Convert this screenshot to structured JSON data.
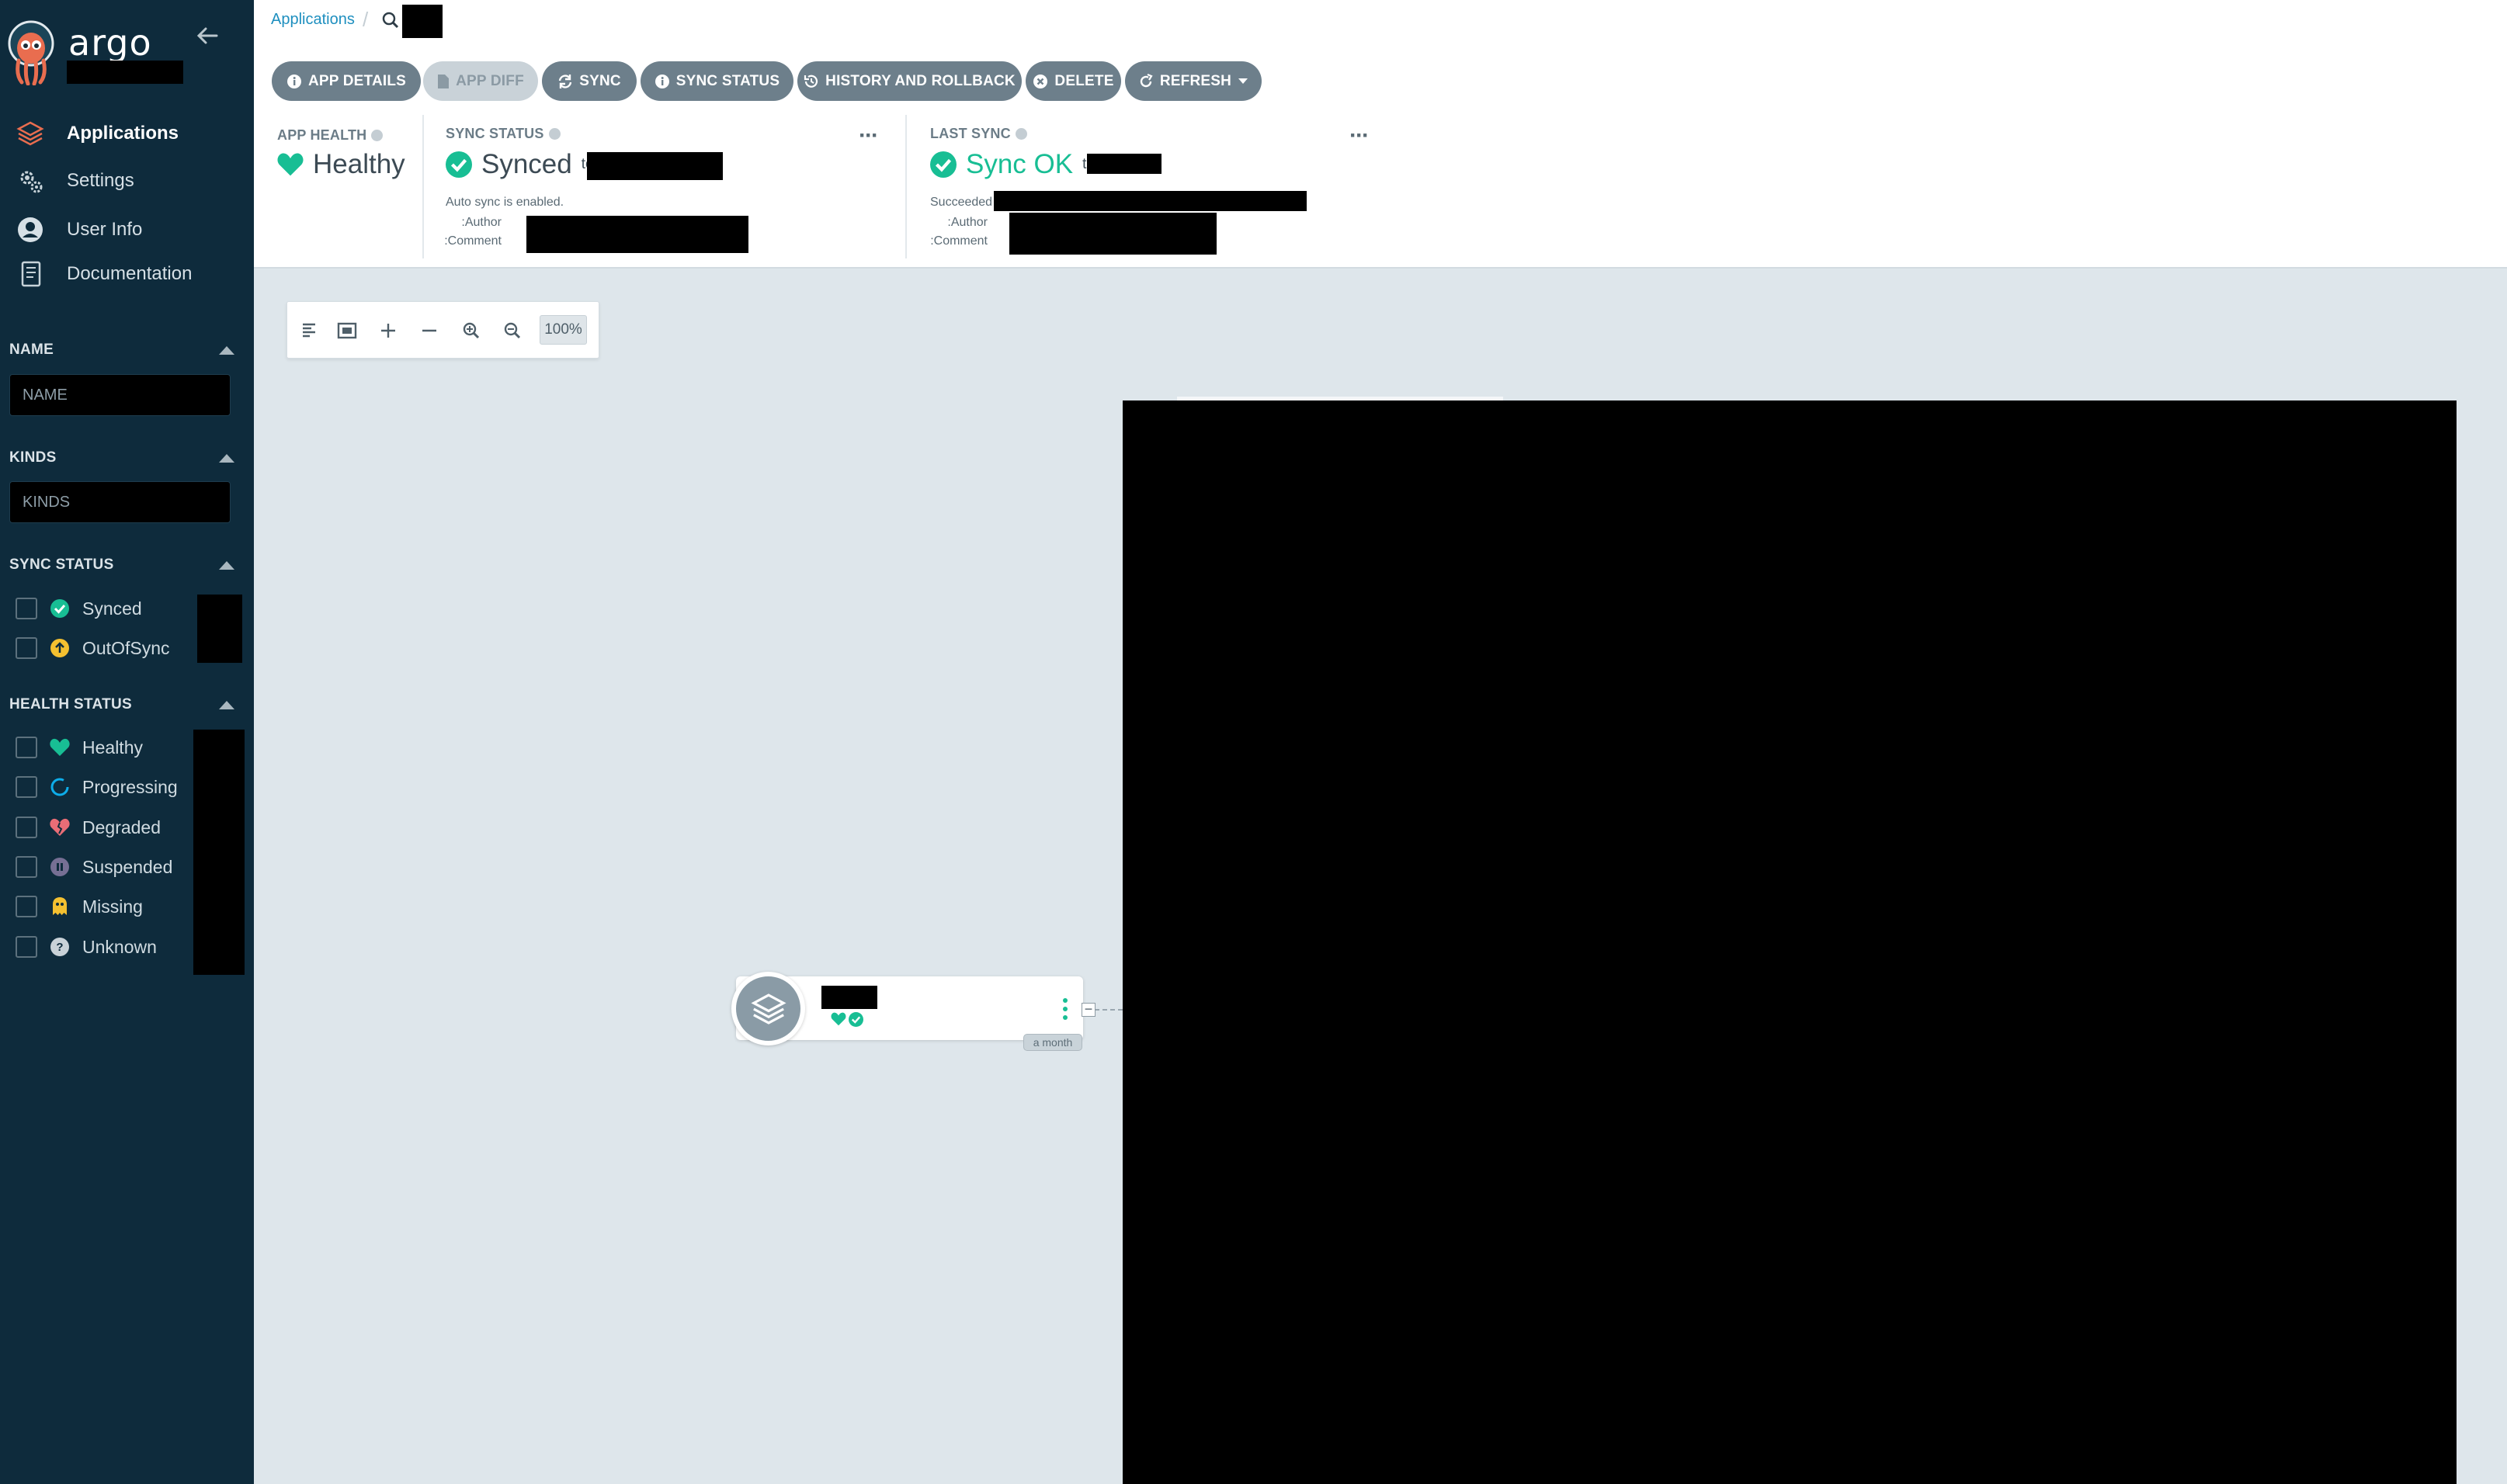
{
  "sidebar": {
    "logo_text": "argo",
    "nav": [
      {
        "label": "Applications",
        "icon": "stack-icon"
      },
      {
        "label": "Settings",
        "icon": "gears-icon"
      },
      {
        "label": "User Info",
        "icon": "user-icon"
      },
      {
        "label": "Documentation",
        "icon": "book-icon"
      }
    ],
    "filters": {
      "name": {
        "title": "NAME",
        "placeholder": "NAME"
      },
      "kinds": {
        "title": "KINDS",
        "placeholder": "KINDS"
      },
      "sync_status": {
        "title": "SYNC STATUS",
        "options": [
          "Synced",
          "OutOfSync"
        ]
      },
      "health_status": {
        "title": "HEALTH STATUS",
        "options": [
          "Healthy",
          "Progressing",
          "Degraded",
          "Suspended",
          "Missing",
          "Unknown"
        ]
      }
    }
  },
  "breadcrumb": {
    "applications": "Applications",
    "separator": "/"
  },
  "actions": {
    "app_details": "APP DETAILS",
    "app_diff": "APP DIFF",
    "sync": "SYNC",
    "sync_status": "SYNC STATUS",
    "history": "HISTORY AND ROLLBACK",
    "delete": "DELETE",
    "refresh": "REFRESH"
  },
  "status": {
    "app_health": {
      "title": "APP HEALTH",
      "value": "Healthy"
    },
    "sync_status": {
      "title": "SYNC STATUS",
      "value": "Synced",
      "to": "to",
      "auto_sync": "Auto sync is enabled.",
      "author_label": "Author:",
      "comment_label": "Comment:"
    },
    "last_sync": {
      "title": "LAST SYNC",
      "value": "Sync OK",
      "to": "to",
      "succeeded_label": "Succeeded",
      "author_label": "Author:",
      "comment_label": "Comment:"
    }
  },
  "graph": {
    "zoom": "100%",
    "node_age": "a month"
  },
  "colors": {
    "sidebar_bg": "#0e2b3c",
    "healthy": "#18be94",
    "out_of_sync": "#f4c030",
    "progressing": "#0dadea",
    "degraded": "#e96d76",
    "suspended": "#766f94",
    "link": "#1e8fbf"
  }
}
